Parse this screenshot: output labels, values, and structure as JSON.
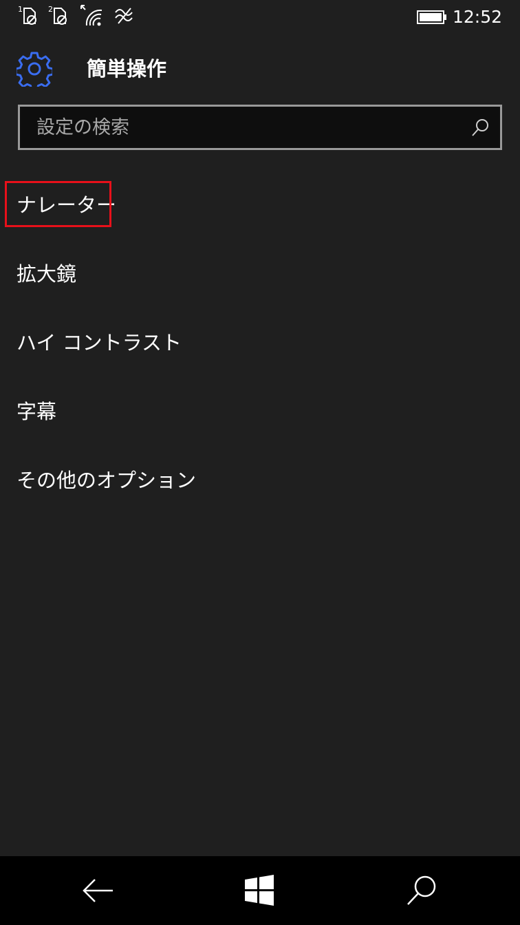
{
  "status_bar": {
    "sim1_label": "1",
    "sim2_label": "2",
    "time": "12:52",
    "icons": [
      "sim1-no-signal-icon",
      "sim2-no-signal-icon",
      "wifi-icon",
      "data-icon",
      "battery-icon"
    ]
  },
  "header": {
    "icon": "gear-icon",
    "title": "簡単操作"
  },
  "search": {
    "placeholder": "設定の検索",
    "value": "",
    "icon": "search-icon"
  },
  "menu": {
    "items": [
      {
        "label": "ナレーター"
      },
      {
        "label": "拡大鏡"
      },
      {
        "label": "ハイ コントラスト"
      },
      {
        "label": "字幕"
      },
      {
        "label": "その他のオプション"
      }
    ]
  },
  "taskbar": {
    "icons": [
      "back-arrow-icon",
      "windows-start-icon",
      "search-icon"
    ]
  },
  "colors": {
    "background": "#1f1f1f",
    "accent": "#3a6df0",
    "highlight": "#e8101a",
    "taskbar": "#000000"
  }
}
